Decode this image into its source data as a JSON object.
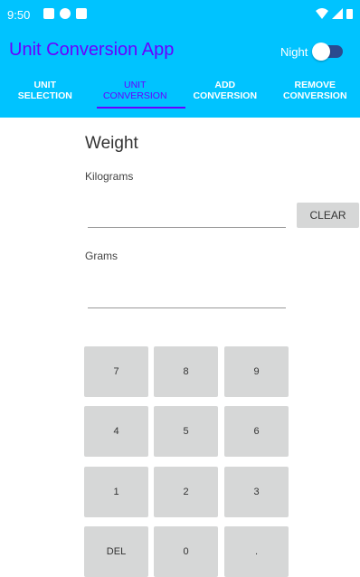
{
  "status": {
    "time": "9:50"
  },
  "appbar": {
    "title": "Unit Conversion App",
    "night_label": "Night",
    "night_enabled": false
  },
  "tabs": [
    {
      "label": "UNIT SELECTION",
      "active": false
    },
    {
      "label": "UNIT CONVERSION",
      "active": true
    },
    {
      "label": "ADD CONVERSION",
      "active": false
    },
    {
      "label": "REMOVE CONVERSION",
      "active": false
    }
  ],
  "conversion": {
    "category": "Weight",
    "from_label": "Kilograms",
    "to_label": "Grams",
    "from_value": "",
    "to_value": "",
    "clear_label": "CLEAR"
  },
  "keypad": {
    "k7": "7",
    "k8": "8",
    "k9": "9",
    "k4": "4",
    "k5": "5",
    "k6": "6",
    "k1": "1",
    "k2": "2",
    "k3": "3",
    "del": "DEL",
    "k0": "0",
    "dot": "."
  },
  "colors": {
    "appbar": "#00c3ff",
    "accent": "#6a00ff",
    "key_bg": "#d6d7d7"
  }
}
